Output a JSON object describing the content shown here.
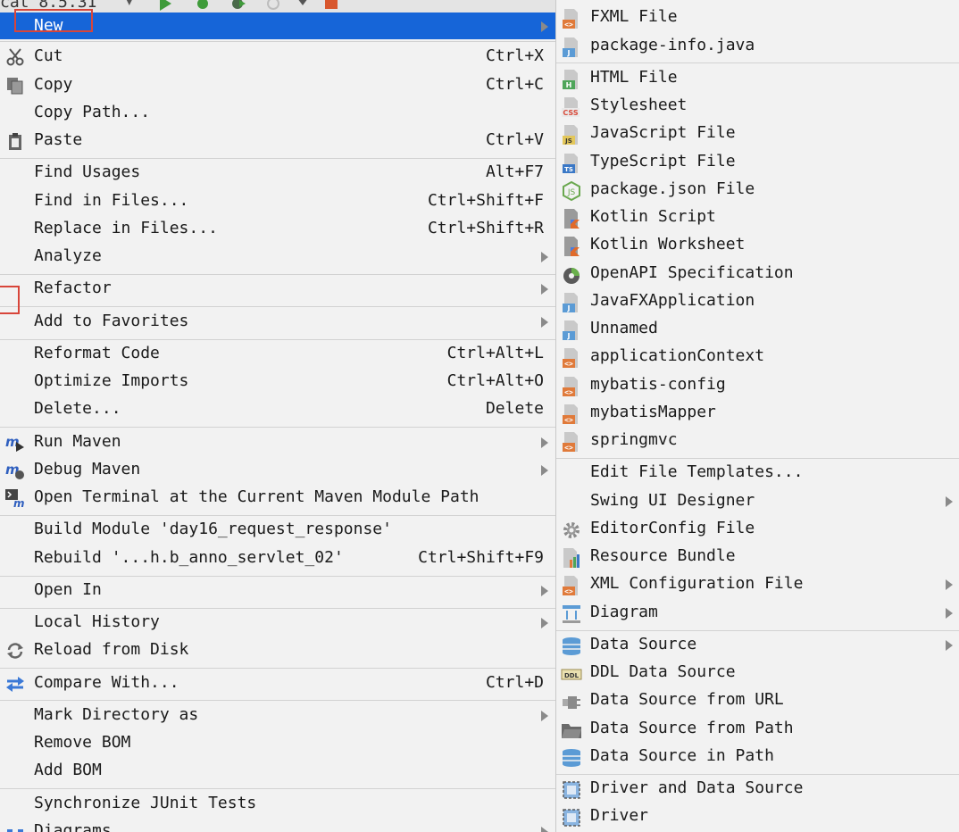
{
  "toolbar": {
    "config_name": "cat 8.5.31"
  },
  "context_menu": {
    "items": [
      {
        "label": "New",
        "shortcut": "",
        "arrow": true
      },
      {
        "label": "Cut",
        "shortcut": "Ctrl+X",
        "icon": "scissors-icon"
      },
      {
        "label": "Copy",
        "shortcut": "Ctrl+C",
        "icon": "copy-icon"
      },
      {
        "label": "Copy Path...",
        "shortcut": ""
      },
      {
        "label": "Paste",
        "shortcut": "Ctrl+V",
        "icon": "clipboard-icon"
      },
      {
        "label": "Find Usages",
        "shortcut": "Alt+F7"
      },
      {
        "label": "Find in Files...",
        "shortcut": "Ctrl+Shift+F"
      },
      {
        "label": "Replace in Files...",
        "shortcut": "Ctrl+Shift+R"
      },
      {
        "label": "Analyze",
        "shortcut": "",
        "arrow": true
      },
      {
        "label": "Refactor",
        "shortcut": "",
        "arrow": true
      },
      {
        "label": "Add to Favorites",
        "shortcut": "",
        "arrow": true
      },
      {
        "label": "Reformat Code",
        "shortcut": "Ctrl+Alt+L"
      },
      {
        "label": "Optimize Imports",
        "shortcut": "Ctrl+Alt+O"
      },
      {
        "label": "Delete...",
        "shortcut": "Delete"
      },
      {
        "label": "Run Maven",
        "shortcut": "",
        "arrow": true,
        "icon": "maven-run-icon"
      },
      {
        "label": "Debug Maven",
        "shortcut": "",
        "arrow": true,
        "icon": "maven-debug-icon"
      },
      {
        "label": "Open Terminal at the Current Maven Module Path",
        "shortcut": "",
        "icon": "maven-terminal-icon"
      },
      {
        "label": "Build Module 'day16_request_response'",
        "shortcut": ""
      },
      {
        "label": "Rebuild '...h.b_anno_servlet_02'",
        "shortcut": "Ctrl+Shift+F9"
      },
      {
        "label": "Open In",
        "shortcut": "",
        "arrow": true
      },
      {
        "label": "Local History",
        "shortcut": "",
        "arrow": true
      },
      {
        "label": "Reload from Disk",
        "shortcut": "",
        "icon": "reload-icon"
      },
      {
        "label": "Compare With...",
        "shortcut": "Ctrl+D",
        "icon": "compare-icon"
      },
      {
        "label": "Mark Directory as",
        "shortcut": "",
        "arrow": true
      },
      {
        "label": "Remove BOM",
        "shortcut": ""
      },
      {
        "label": "Add BOM",
        "shortcut": ""
      },
      {
        "label": "Synchronize JUnit Tests",
        "shortcut": ""
      },
      {
        "label": "Diagrams",
        "shortcut": "",
        "arrow": true,
        "icon": "diagram-icon"
      }
    ]
  },
  "new_submenu": {
    "items": [
      {
        "label": "FXML File",
        "icon": "xml-file-icon"
      },
      {
        "label": "package-info.java",
        "icon": "java-file-icon"
      },
      {
        "label": "HTML File",
        "icon": "html-file-icon"
      },
      {
        "label": "Stylesheet",
        "icon": "css-file-icon"
      },
      {
        "label": "JavaScript File",
        "icon": "js-file-icon"
      },
      {
        "label": "TypeScript File",
        "icon": "ts-file-icon"
      },
      {
        "label": "package.json File",
        "icon": "nodejs-icon"
      },
      {
        "label": "Kotlin Script",
        "icon": "kotlin-file-icon"
      },
      {
        "label": "Kotlin Worksheet",
        "icon": "kotlin-file-icon"
      },
      {
        "label": "OpenAPI Specification",
        "icon": "openapi-icon"
      },
      {
        "label": "JavaFXApplication",
        "icon": "java-file-icon"
      },
      {
        "label": "Unnamed",
        "icon": "java-file-icon"
      },
      {
        "label": "applicationContext",
        "icon": "xml-file-icon"
      },
      {
        "label": "mybatis-config",
        "icon": "xml-file-icon"
      },
      {
        "label": "mybatisMapper",
        "icon": "xml-file-icon"
      },
      {
        "label": "springmvc",
        "icon": "xml-file-icon"
      },
      {
        "label": "Edit File Templates...",
        "icon": ""
      },
      {
        "label": "Swing UI Designer",
        "icon": "",
        "arrow": true
      },
      {
        "label": "EditorConfig File",
        "icon": "gear-icon"
      },
      {
        "label": "Resource Bundle",
        "icon": "resource-bundle-icon"
      },
      {
        "label": "XML Configuration File",
        "icon": "xml-file-icon",
        "arrow": true
      },
      {
        "label": "Diagram",
        "icon": "diagram-icon",
        "arrow": true
      },
      {
        "label": "Data Source",
        "icon": "database-icon",
        "arrow": true
      },
      {
        "label": "DDL Data Source",
        "icon": "ddl-icon"
      },
      {
        "label": "Data Source from URL",
        "icon": "plug-icon"
      },
      {
        "label": "Data Source from Path",
        "icon": "folder-icon"
      },
      {
        "label": "Data Source in Path",
        "icon": "database-icon"
      },
      {
        "label": "Driver and Data Source",
        "icon": "driver-icon"
      },
      {
        "label": "Driver",
        "icon": "driver-icon"
      }
    ]
  }
}
